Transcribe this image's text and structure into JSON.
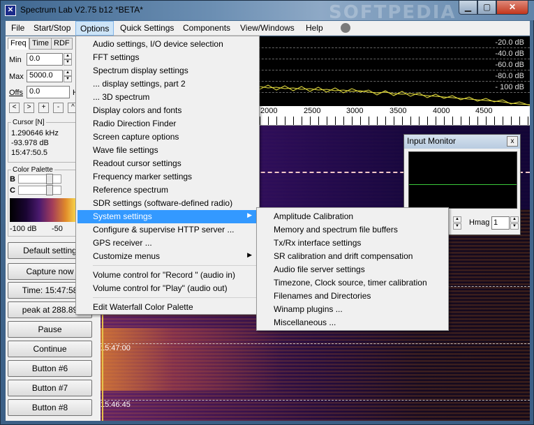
{
  "window": {
    "title": "Spectrum Lab V2.75 b12 *BETA*",
    "watermark": "SOFTPEDIA",
    "min_glyph": "▁",
    "max_glyph": "▢",
    "close_glyph": "✕"
  },
  "menubar": [
    {
      "label": "File"
    },
    {
      "label": "Start/Stop"
    },
    {
      "label": "Options"
    },
    {
      "label": "Quick Settings"
    },
    {
      "label": "Components"
    },
    {
      "label": "View/Windows"
    },
    {
      "label": "Help"
    }
  ],
  "left": {
    "tabs": [
      "Freq",
      "Time",
      "RDF"
    ],
    "min_label": "Min",
    "min_value": "0.0",
    "max_label": "Max",
    "max_value": "5000.0",
    "offs_label": "Offs",
    "offs_value": "0.0",
    "offs_suffix": "H",
    "nav_buttons": [
      "<",
      ">",
      "+",
      "-",
      "^"
    ],
    "cursor_group": "Cursor [N]",
    "cursor_freq": "1.290646 kHz",
    "cursor_db": "-93.978 dB",
    "cursor_time": "15:47:50.5",
    "palette_group": "Color Palette",
    "palette_b": "B",
    "palette_c": "C",
    "palette_min": "-100 dB",
    "palette_max": "-50",
    "buttons": [
      "Default setting",
      "Capture now",
      "Time:  15:47:58",
      "peak at 288.89",
      "Pause",
      "Continue",
      "Button #6",
      "Button #7",
      "Button #8"
    ]
  },
  "spectrum": {
    "db_labels": [
      "-20.0 dB",
      "-40.0 dB",
      "-60.0 dB",
      "-80.0 dB",
      "- 100 dB"
    ],
    "freq_labels": [
      "2000",
      "2500",
      "3000",
      "3500",
      "4000",
      "4500"
    ],
    "trace_color": "#e8e040"
  },
  "waterfall": {
    "times": [
      "15:47:00",
      "15:46:45"
    ]
  },
  "input_monitor": {
    "title": "Input Monitor",
    "close_glyph": "x",
    "hmag_label": "Hmag",
    "hmag_value": "1"
  },
  "options_menu": {
    "items": [
      {
        "label": "Audio settings, I/O device selection"
      },
      {
        "label": "FFT settings"
      },
      {
        "label": "Spectrum display settings"
      },
      {
        "label": " ... display settings, part 2"
      },
      {
        "label": " ... 3D spectrum"
      },
      {
        "label": "Display colors and fonts"
      },
      {
        "label": "Radio Direction Finder"
      },
      {
        "label": "Screen capture options"
      },
      {
        "label": "Wave file settings"
      },
      {
        "label": "Readout cursor settings"
      },
      {
        "label": "Frequency marker settings"
      },
      {
        "label": "Reference spectrum"
      },
      {
        "label": "SDR settings (software-defined radio)"
      },
      {
        "label": "System settings",
        "submenu": true
      },
      {
        "label": "Configure & supervise HTTP server ..."
      },
      {
        "label": "GPS receiver ..."
      },
      {
        "label": "Customize menus",
        "submenu": true
      },
      {
        "label": "Volume control for \"Record \" (audio in)"
      },
      {
        "label": "Volume control for \"Play\" (audio out)"
      },
      {
        "label": "Edit Waterfall Color Palette"
      }
    ],
    "submenu_arrow": "▶"
  },
  "system_submenu": {
    "items": [
      "Amplitude Calibration",
      "Memory and spectrum file buffers",
      "Tx/Rx interface settings",
      "SR calibration and  drift compensation",
      "Audio file server settings",
      "Timezone, Clock source, timer calibration",
      "Filenames and Directories",
      "Winamp plugins ...",
      "Miscellaneous ..."
    ]
  }
}
